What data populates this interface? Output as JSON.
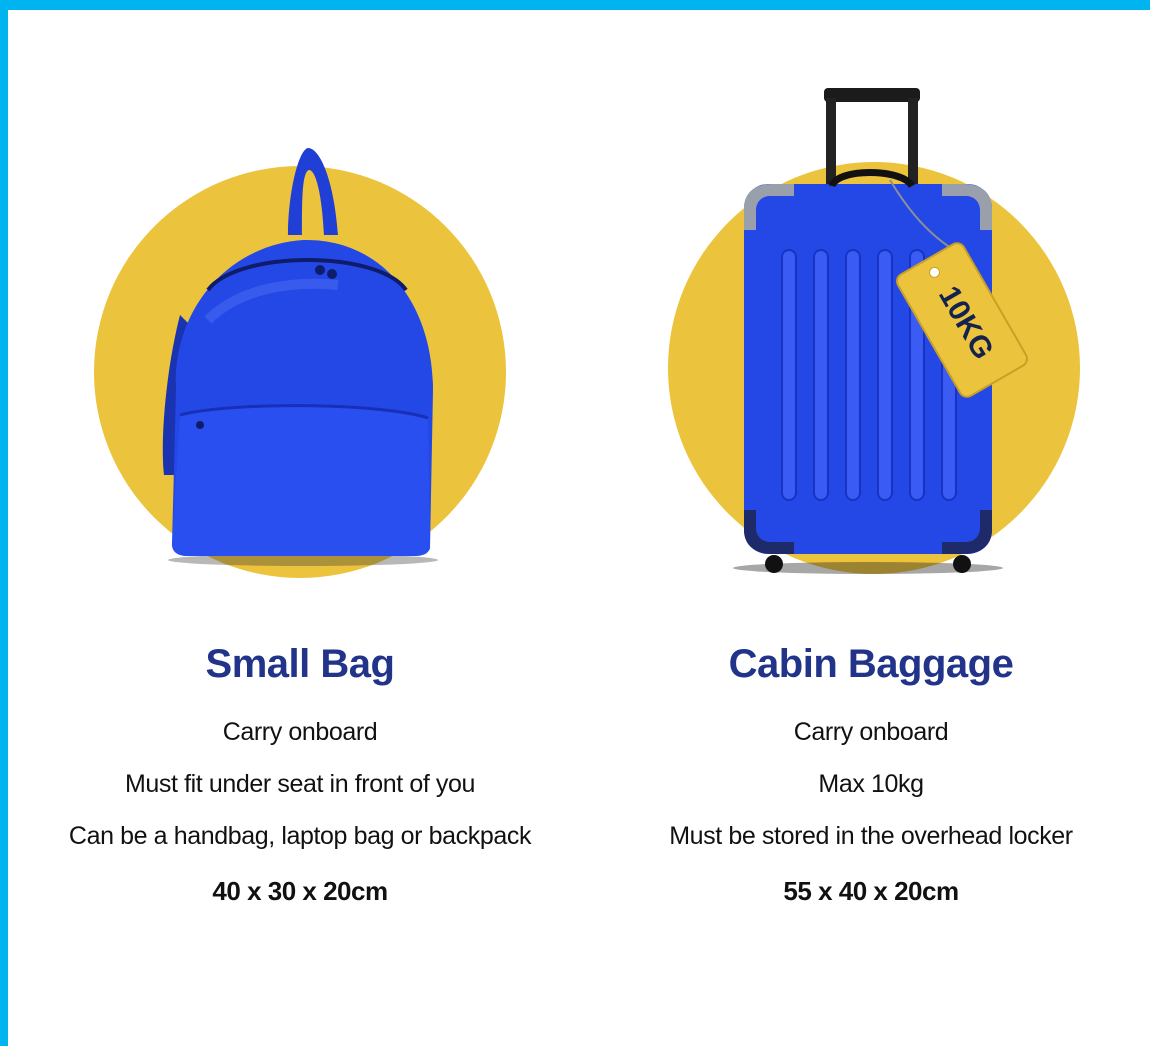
{
  "colors": {
    "border": "#00b4f0",
    "circle": "#ecc33c",
    "bag_blue": "#2448e6",
    "title_navy": "#22338a"
  },
  "cards": [
    {
      "icon": "backpack-icon",
      "title": "Small Bag",
      "lines": [
        "Carry onboard",
        "Must fit under seat in front of you",
        "Can be a handbag, laptop bag or backpack"
      ],
      "dimensions": "40 x 30 x 20cm"
    },
    {
      "icon": "suitcase-icon",
      "title": "Cabin Baggage",
      "tag_text": "10KG",
      "lines": [
        "Carry onboard",
        "Max 10kg",
        "Must be stored in the overhead locker"
      ],
      "dimensions": "55 x 40 x 20cm"
    }
  ]
}
